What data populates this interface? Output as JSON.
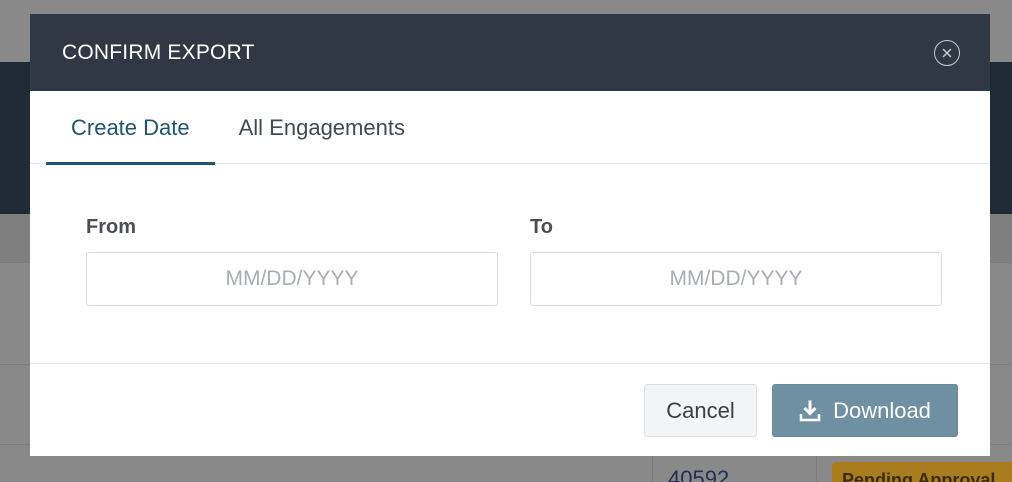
{
  "background": {
    "table_cell_value": "40592",
    "status_badge": "Pending Approval"
  },
  "modal": {
    "title": "CONFIRM EXPORT",
    "close_icon": "close-circle-icon",
    "tabs": [
      {
        "label": "Create Date",
        "active": true
      },
      {
        "label": "All Engagements",
        "active": false
      }
    ],
    "from": {
      "label": "From",
      "placeholder": "MM/DD/YYYY",
      "value": ""
    },
    "to": {
      "label": "To",
      "placeholder": "MM/DD/YYYY",
      "value": ""
    },
    "cancel_label": "Cancel",
    "download_label": "Download",
    "download_icon": "download-icon"
  },
  "colors": {
    "header_bg": "#2f3844",
    "accent": "#1f5473",
    "download_button": "#6f8fa2"
  }
}
